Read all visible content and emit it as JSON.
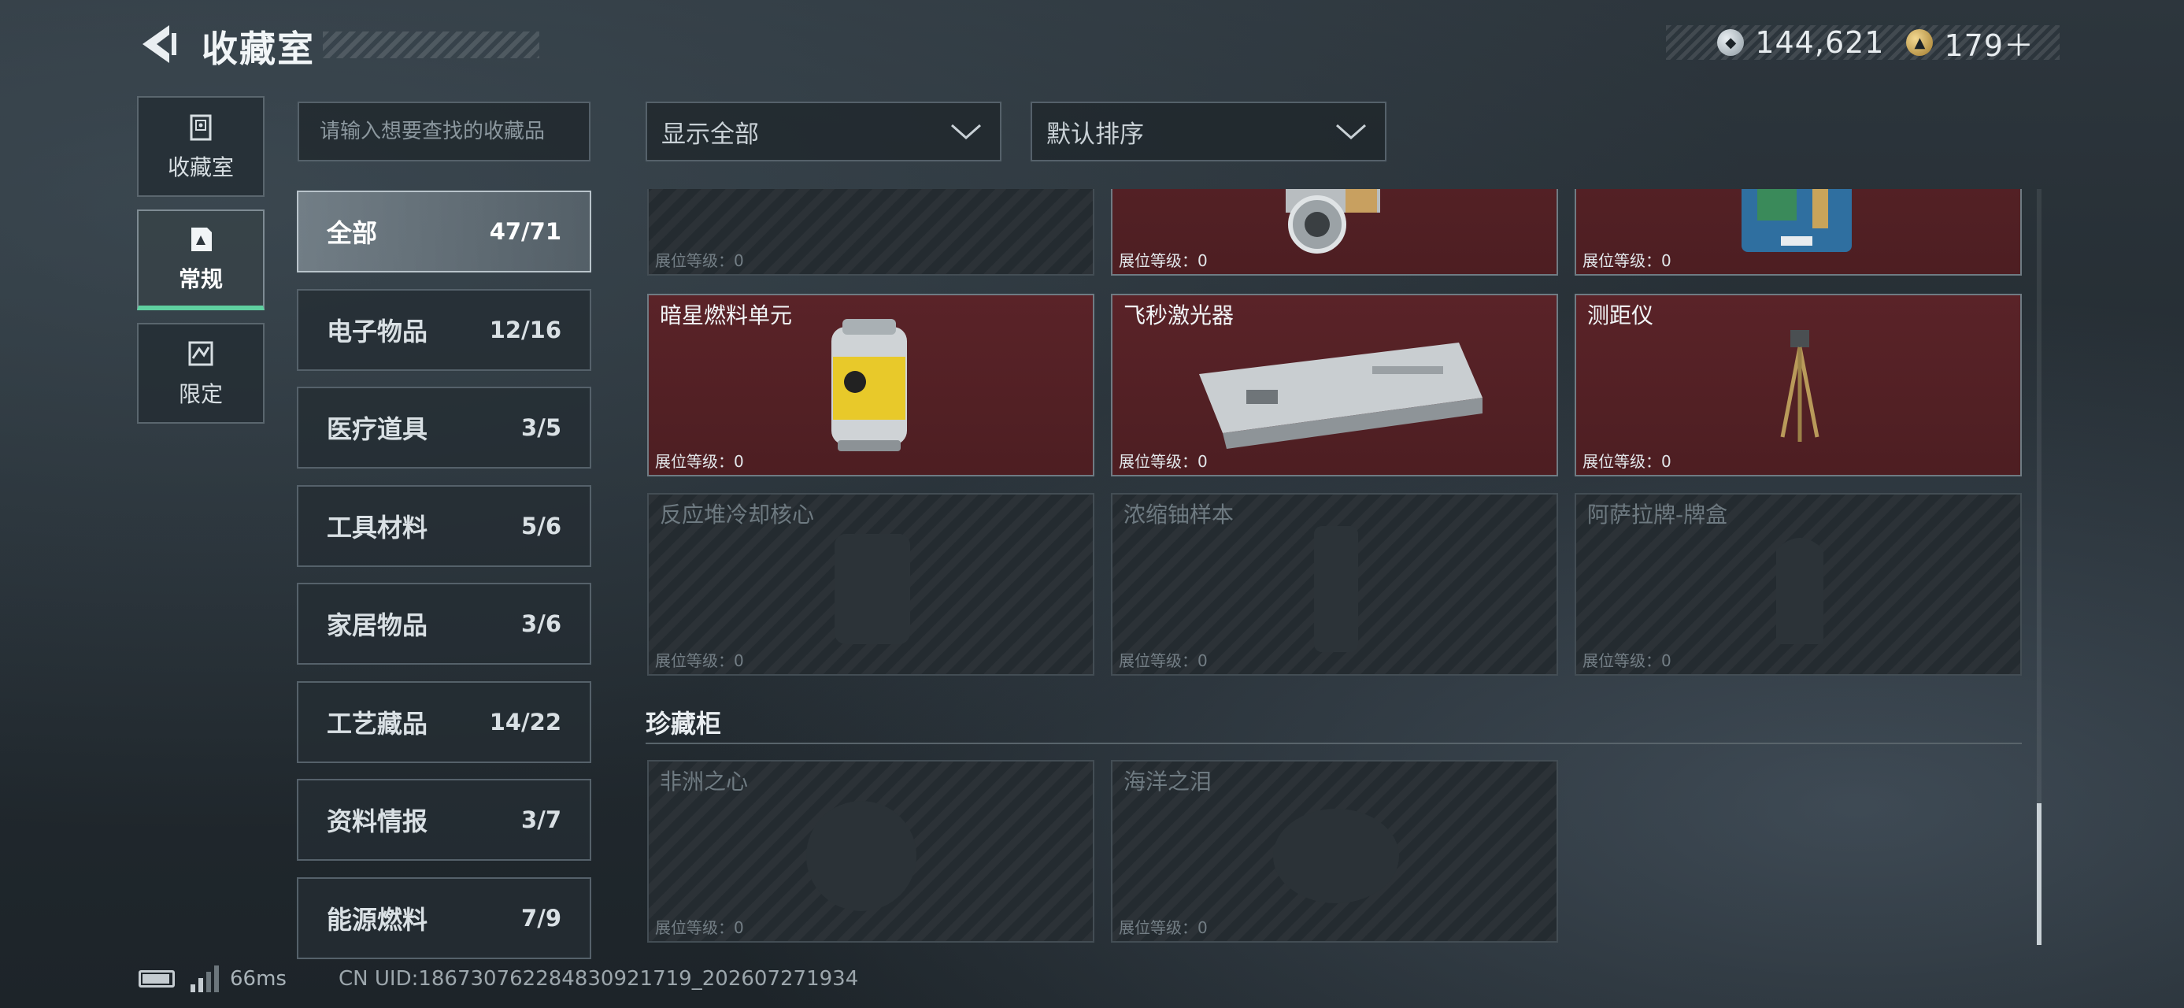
{
  "header": {
    "title": "收藏室",
    "currency_1": "144,621",
    "currency_2": "179＋"
  },
  "nav": [
    {
      "label": "收藏室",
      "icon": "vault-icon"
    },
    {
      "label": "常规",
      "icon": "document-icon",
      "active": true
    },
    {
      "label": "限定",
      "icon": "limited-icon"
    }
  ],
  "search": {
    "placeholder": "请输入想要查找的收藏品"
  },
  "filters": {
    "show": "显示全部",
    "sort": "默认排序"
  },
  "categories": [
    {
      "name": "全部",
      "count": "47/71",
      "active": true
    },
    {
      "name": "电子物品",
      "count": "12/16"
    },
    {
      "name": "医疗道具",
      "count": "3/5"
    },
    {
      "name": "工具材料",
      "count": "5/6"
    },
    {
      "name": "家居物品",
      "count": "3/6"
    },
    {
      "name": "工艺藏品",
      "count": "14/22"
    },
    {
      "name": "资料情报",
      "count": "3/7"
    },
    {
      "name": "能源燃料",
      "count": "7/9"
    }
  ],
  "items_row0": [
    {
      "level": "展位等级：0",
      "owned": false
    },
    {
      "level": "展位等级：0",
      "owned": true
    },
    {
      "level": "展位等级：0",
      "owned": true
    }
  ],
  "items_row1": [
    {
      "name": "暗星燃料单元",
      "level": "展位等级：0",
      "owned": true
    },
    {
      "name": "飞秒激光器",
      "level": "展位等级：0",
      "owned": true
    },
    {
      "name": "测距仪",
      "level": "展位等级：0",
      "owned": true
    }
  ],
  "items_row2": [
    {
      "name": "反应堆冷却核心",
      "level": "展位等级：0",
      "owned": false
    },
    {
      "name": "浓缩铀样本",
      "level": "展位等级：0",
      "owned": false
    },
    {
      "name": "阿萨拉牌-牌盒",
      "level": "展位等级：0",
      "owned": false
    }
  ],
  "cabinet": {
    "title": "珍藏柜",
    "items": [
      {
        "name": "非洲之心",
        "level": "展位等级：0",
        "owned": false
      },
      {
        "name": "海洋之泪",
        "level": "展位等级：0",
        "owned": false
      }
    ]
  },
  "footer": {
    "ping": "66ms",
    "uid": "CN UID:18673076228483092171​9_202607271934"
  },
  "colors": {
    "accent_green": "#5fd0a0",
    "owned_card": "#5a2328",
    "locked_card": "#242b30"
  }
}
